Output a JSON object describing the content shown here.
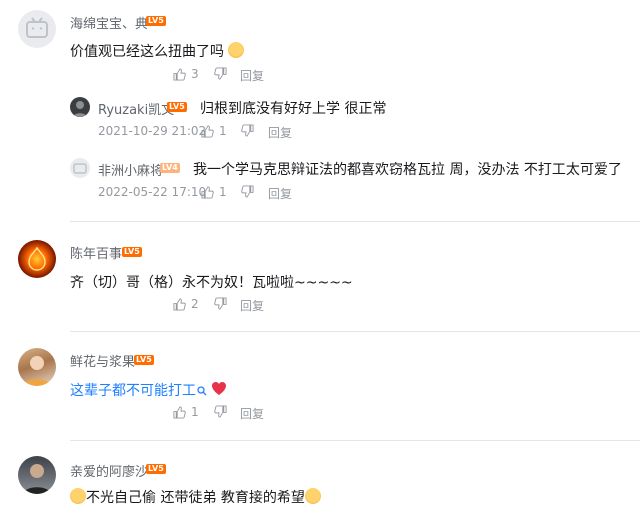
{
  "comments": [
    {
      "user": "海绵宝宝、典",
      "level": "LV5",
      "text": "价值观已经这么扭曲了吗",
      "likes": "3",
      "reply_label": "回复",
      "replies": [
        {
          "user": "Ryuzaki凯文",
          "level": "LV5",
          "text": "归根到底没有好好上学  很正常",
          "time": "2021-10-29 21:02",
          "likes": "1",
          "reply_label": "回复"
        },
        {
          "user": "非洲小麻将",
          "level": "LV4",
          "text": "我一个学马克思辩证法的都喜欢窃格瓦拉 周，没办法 不打工太可爱了",
          "time": "2022-05-22 17:10",
          "likes": "1",
          "reply_label": "回复"
        }
      ]
    },
    {
      "user": "陈年百事",
      "level": "LV5",
      "text": "齐（切）哥（格）永不为奴！瓦啦啦~~~~~",
      "likes": "2",
      "reply_label": "回复"
    },
    {
      "user": "鲜花与浆果",
      "level": "LV5",
      "text": "这辈子都不可能打工",
      "likes": "1",
      "reply_label": "回复"
    },
    {
      "user": "亲爱的阿廖沙",
      "level": "LV5",
      "text": "不光自己偷  还带徒弟  教育接的希望"
    }
  ],
  "colors": {
    "lv5": "#ff6c00",
    "lv4": "#ffb37c",
    "link": "#1e80ff",
    "heart": "#e8324a"
  },
  "icons": {
    "like": "thumbs-up-icon",
    "emoji": "emoji-icon",
    "search": "search-icon",
    "heart": "heart-icon"
  }
}
